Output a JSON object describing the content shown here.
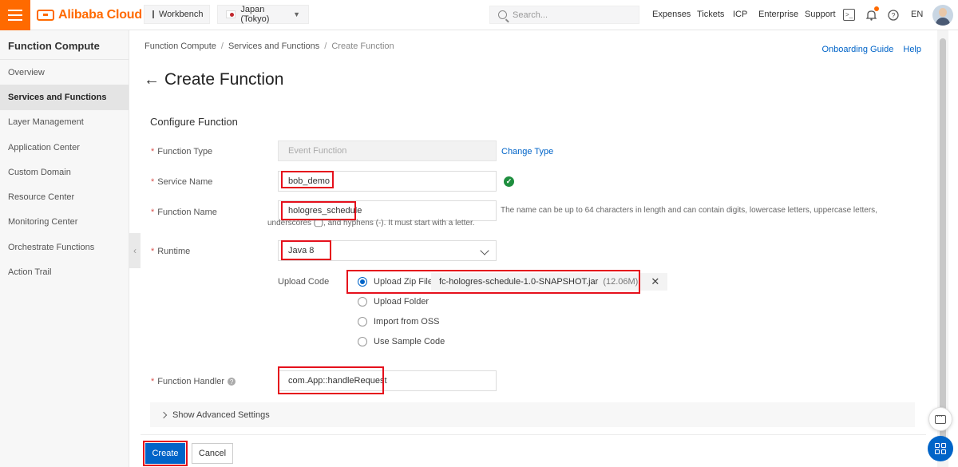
{
  "topbar": {
    "logo_text": "Alibaba Cloud",
    "workbench_label": "Workbench",
    "region_label": "Japan (Tokyo)",
    "search_placeholder": "Search...",
    "links": [
      "Expenses",
      "Tickets",
      "ICP",
      "Enterprise",
      "Support"
    ],
    "lang": "EN",
    "accent_color": "#ff6a00"
  },
  "sidebar": {
    "title": "Function Compute",
    "items": [
      {
        "label": "Overview"
      },
      {
        "label": "Services and Functions"
      },
      {
        "label": "Layer Management"
      },
      {
        "label": "Application Center"
      },
      {
        "label": "Custom Domain"
      },
      {
        "label": "Resource Center"
      },
      {
        "label": "Monitoring Center"
      },
      {
        "label": "Orchestrate Functions"
      },
      {
        "label": "Action Trail"
      }
    ]
  },
  "breadcrumb": [
    "Function Compute",
    "Services and Functions",
    "Create Function"
  ],
  "header_links": {
    "onboarding": "Onboarding Guide",
    "help": "Help"
  },
  "page_title": "Create Function",
  "form": {
    "section_title": "Configure Function",
    "function_type": {
      "label": "Function Type",
      "value": "Event Function",
      "change_link": "Change Type"
    },
    "service_name": {
      "label": "Service Name",
      "value": "bob_demo"
    },
    "function_name": {
      "label": "Function Name",
      "value": "hologres_schedule",
      "hint": "The name can be up to 64 characters in length and can contain digits, lowercase letters, uppercase letters, underscores (_), and hyphens (-). It must start with a letter."
    },
    "runtime": {
      "label": "Runtime",
      "value": "Java 8"
    },
    "upload_code": {
      "label": "Upload Code",
      "options": [
        "Upload Zip File",
        "Upload Folder",
        "Import from OSS",
        "Use Sample Code"
      ],
      "selected": "Upload Zip File",
      "file_name": "fc-hologres-schedule-1.0-SNAPSHOT.jar",
      "file_size": "(12.06M)"
    },
    "handler": {
      "label": "Function Handler",
      "value": "com.App::handleRequest"
    },
    "advanced_label": "Show Advanced Settings"
  },
  "footer": {
    "create_label": "Create",
    "cancel_label": "Cancel"
  },
  "colors": {
    "primary": "#0064c8",
    "highlight": "#e5101c",
    "success": "#1e8e3e"
  }
}
